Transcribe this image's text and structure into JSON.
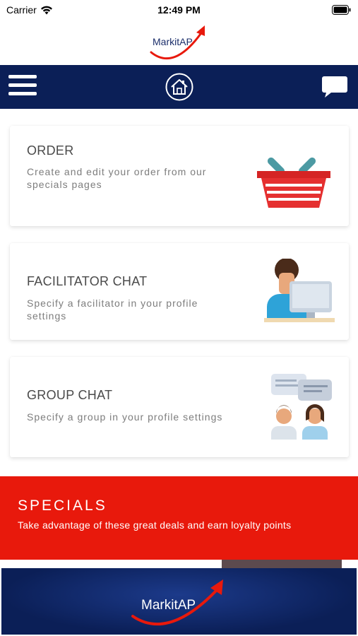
{
  "status_bar": {
    "carrier": "Carrier",
    "time": "12:49 PM"
  },
  "brand": {
    "name": "MarkitAP",
    "navy": "#0b1f57",
    "red": "#e8190c"
  },
  "navbar": {
    "icons": [
      "menu-icon",
      "home-icon",
      "chat-bubble-icon"
    ]
  },
  "cards": [
    {
      "title": "ORDER",
      "description": "Create and edit your order from our specials pages",
      "icon": "shopping-basket-icon"
    },
    {
      "title": "FACILITATOR CHAT",
      "description": "Specify a facilitator in your profile settings",
      "icon": "facilitator-at-computer-icon"
    },
    {
      "title": "GROUP CHAT",
      "description": "Specify a group in your profile settings",
      "icon": "group-chat-icon"
    }
  ],
  "specials": {
    "title": "SPECIALS",
    "subtitle": "Take advantage of these great deals and earn loyalty points"
  },
  "banner": {
    "brand": "MarkitAP"
  }
}
